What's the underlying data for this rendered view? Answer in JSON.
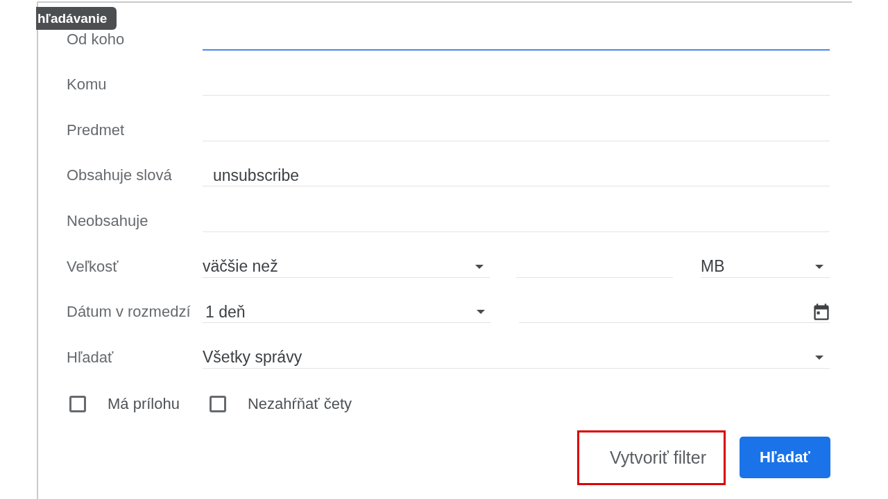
{
  "tooltip": {
    "text": "hľadávanie"
  },
  "fields": [
    {
      "kind": "text",
      "label": "Od koho",
      "focused": true
    },
    {
      "kind": "text",
      "label": "Komu",
      "focused": false
    },
    {
      "kind": "text",
      "label": "Predmet",
      "focused": false
    },
    {
      "kind": "text",
      "label": "Obsahuje slová",
      "value": "unsubscribe",
      "focused": false
    },
    {
      "kind": "text",
      "label": "Neobsahuje",
      "focused": false
    },
    {
      "kind": "size",
      "label": "Veľkosť",
      "comparison": "väčšie než",
      "unit": "MB"
    },
    {
      "kind": "date",
      "label": "Dátum v rozmedzí",
      "range": "1 deň"
    },
    {
      "kind": "select",
      "label": "Hľadať",
      "value": "Všetky správy"
    }
  ],
  "checkboxes": [
    {
      "label": "Má prílohu",
      "checked": false
    },
    {
      "label": "Nezahŕňať čety",
      "checked": false
    }
  ],
  "buttons": [
    {
      "kind": "flat",
      "label": "Vytvoriť filter",
      "highlighted": true
    },
    {
      "kind": "filled",
      "label": "Hľadať",
      "highlighted": false
    }
  ]
}
